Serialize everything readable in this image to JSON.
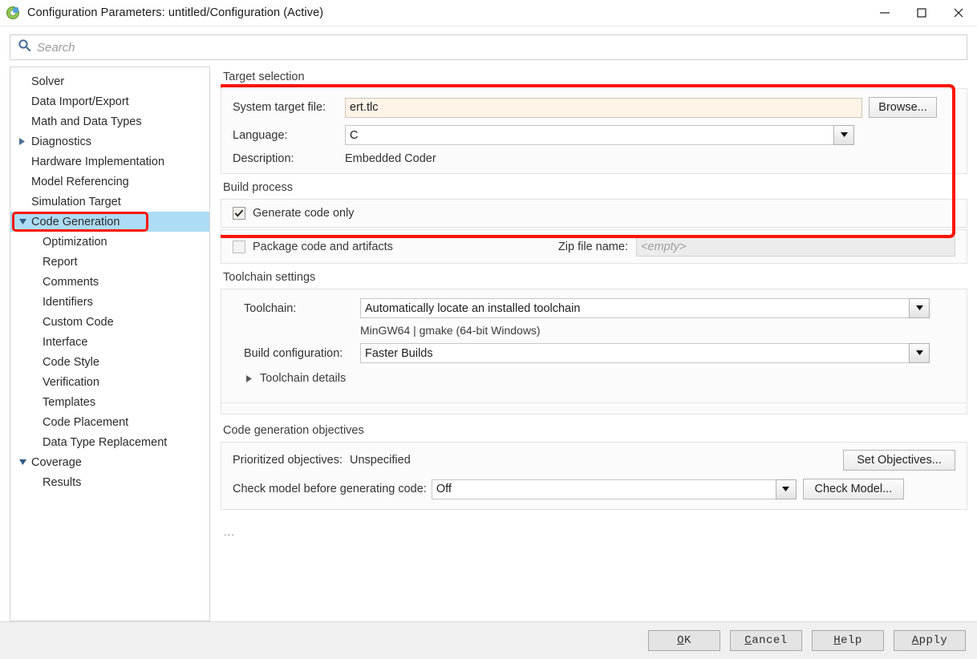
{
  "window": {
    "title": "Configuration Parameters: untitled/Configuration (Active)",
    "app_icon": "simulink-icon",
    "minimize_label": "–",
    "maximize_label": "☐",
    "close_label": "✕"
  },
  "search": {
    "placeholder": "Search",
    "value": "",
    "icon": "search-icon"
  },
  "sidebar": {
    "items": [
      {
        "label": "Solver",
        "level": 1,
        "twisty": "none",
        "selected": false
      },
      {
        "label": "Data Import/Export",
        "level": 1,
        "twisty": "none",
        "selected": false
      },
      {
        "label": "Math and Data Types",
        "level": 1,
        "twisty": "none",
        "selected": false
      },
      {
        "label": "Diagnostics",
        "level": 1,
        "twisty": "collapsed",
        "selected": false
      },
      {
        "label": "Hardware Implementation",
        "level": 1,
        "twisty": "none",
        "selected": false
      },
      {
        "label": "Model Referencing",
        "level": 1,
        "twisty": "none",
        "selected": false
      },
      {
        "label": "Simulation Target",
        "level": 1,
        "twisty": "none",
        "selected": false
      },
      {
        "label": "Code Generation",
        "level": 1,
        "twisty": "expanded",
        "selected": true,
        "annotated": true
      },
      {
        "label": "Optimization",
        "level": 2,
        "twisty": "none",
        "selected": false
      },
      {
        "label": "Report",
        "level": 2,
        "twisty": "none",
        "selected": false
      },
      {
        "label": "Comments",
        "level": 2,
        "twisty": "none",
        "selected": false
      },
      {
        "label": "Identifiers",
        "level": 2,
        "twisty": "none",
        "selected": false
      },
      {
        "label": "Custom Code",
        "level": 2,
        "twisty": "none",
        "selected": false
      },
      {
        "label": "Interface",
        "level": 2,
        "twisty": "none",
        "selected": false
      },
      {
        "label": "Code Style",
        "level": 2,
        "twisty": "none",
        "selected": false
      },
      {
        "label": "Verification",
        "level": 2,
        "twisty": "none",
        "selected": false
      },
      {
        "label": "Templates",
        "level": 2,
        "twisty": "none",
        "selected": false
      },
      {
        "label": "Code Placement",
        "level": 2,
        "twisty": "none",
        "selected": false
      },
      {
        "label": "Data Type Replacement",
        "level": 2,
        "twisty": "none",
        "selected": false
      },
      {
        "label": "Coverage",
        "level": 1,
        "twisty": "expanded",
        "selected": false
      },
      {
        "label": "Results",
        "level": 2,
        "twisty": "none",
        "selected": false
      }
    ]
  },
  "target_selection": {
    "title": "Target selection",
    "system_target_file_label": "System target file:",
    "system_target_file_value": "ert.tlc",
    "browse_label": "Browse...",
    "language_label": "Language:",
    "language_value": "C",
    "description_label": "Description:",
    "description_value": "Embedded Coder"
  },
  "build_process": {
    "title": "Build process",
    "generate_code_only_label": "Generate code only",
    "generate_code_only_checked": true,
    "package_code_label": "Package code and artifacts",
    "package_code_checked": false,
    "zip_file_name_label": "Zip file name:",
    "zip_file_name_placeholder": "<empty>",
    "zip_file_name_value": ""
  },
  "toolchain_settings": {
    "title": "Toolchain settings",
    "toolchain_label": "Toolchain:",
    "toolchain_value": "Automatically locate an installed toolchain",
    "toolchain_detail": "MinGW64 | gmake (64-bit Windows)",
    "build_configuration_label": "Build configuration:",
    "build_configuration_value": "Faster Builds",
    "toolchain_details_label": "Toolchain details"
  },
  "code_generation_objectives": {
    "title": "Code generation objectives",
    "prioritized_objectives_label": "Prioritized objectives:",
    "prioritized_objectives_value": "Unspecified",
    "set_objectives_label": "Set Objectives...",
    "check_model_label": "Check model before generating code:",
    "check_model_value": "Off",
    "check_model_button_label": "Check Model..."
  },
  "overflow_note": "...",
  "footer": {
    "ok": {
      "mnemonic": "O",
      "rest": "K"
    },
    "cancel": {
      "mnemonic": "C",
      "rest": "ancel"
    },
    "help": {
      "mnemonic": "H",
      "rest": "elp"
    },
    "apply": {
      "mnemonic": "A",
      "rest": "pply"
    }
  },
  "colors": {
    "selection": "#addcf5",
    "annotation": "#fa1405",
    "cream_field": "#fdf3e6",
    "panel_bg": "#fbfbfb"
  }
}
